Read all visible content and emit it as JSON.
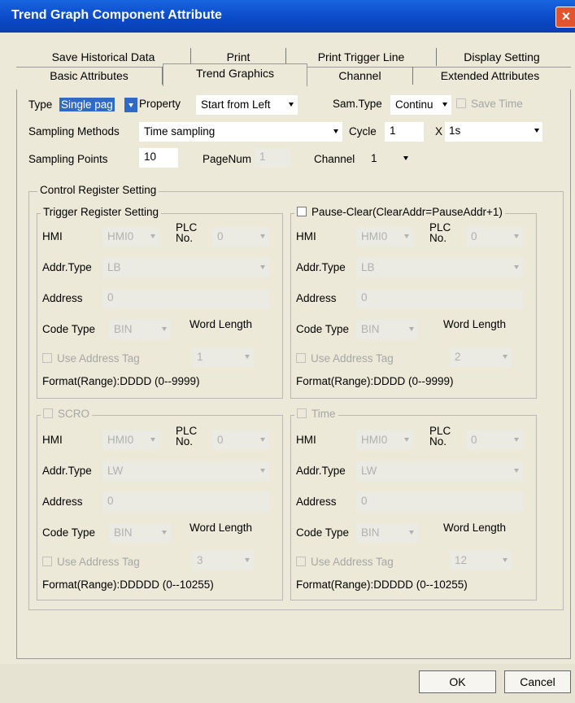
{
  "window": {
    "title": "Trend Graph Component Attribute",
    "close": "×"
  },
  "tabs": {
    "row1": [
      "Save Historical Data",
      "Print",
      "Print Trigger Line",
      "Display Setting"
    ],
    "row2": [
      "Basic Attributes",
      "Trend Graphics",
      "Channel",
      "Extended Attributes"
    ],
    "active": "Trend Graphics"
  },
  "top": {
    "type_label": "Type",
    "type_value": "Single pag",
    "property_label": "Property",
    "property_value": "Start from Left",
    "samtype_label": "Sam.Type",
    "samtype_value": "Continu",
    "savetime_label": "Save Time",
    "sampling_methods_label": "Sampling Methods",
    "sampling_methods_value": "Time sampling",
    "cycle_label": "Cycle",
    "cycle_value": "1",
    "times": "X",
    "cycle_unit": "1s",
    "sampling_points_label": "Sampling Points",
    "sampling_points_value": "10",
    "pagenum_label": "PageNum",
    "pagenum_value": "1",
    "channel_label": "Channel",
    "channel_value": "1"
  },
  "control": {
    "title": "Control Register Setting",
    "groups": [
      {
        "title": "Trigger Register Setting",
        "checkbox": false,
        "hmi": "HMI",
        "hmi_value": "HMI0",
        "plc": "PLC\nNo.",
        "plc_value": "0",
        "addrtype": "Addr.Type",
        "addrtype_value": "LB",
        "address": "Address",
        "address_value": "0",
        "codetype": "Code Type",
        "codetype_value": "BIN",
        "wordlength": "Word Length",
        "wordlength_value": "1",
        "use_tag": "Use Address Tag",
        "format": "Format(Range):DDDD (0--9999)"
      },
      {
        "title": "Pause-Clear(ClearAddr=PauseAddr+1)",
        "checkbox": true,
        "hmi": "HMI",
        "hmi_value": "HMI0",
        "plc": "PLC\nNo.",
        "plc_value": "0",
        "addrtype": "Addr.Type",
        "addrtype_value": "LB",
        "address": "Address",
        "address_value": "0",
        "codetype": "Code Type",
        "codetype_value": "BIN",
        "wordlength": "Word Length",
        "wordlength_value": "2",
        "use_tag": "Use Address Tag",
        "format": "Format(Range):DDDD (0--9999)"
      },
      {
        "title": "SCRO",
        "checkbox": true,
        "hmi": "HMI",
        "hmi_value": "HMI0",
        "plc": "PLC\nNo.",
        "plc_value": "0",
        "addrtype": "Addr.Type",
        "addrtype_value": "LW",
        "address": "Address",
        "address_value": "0",
        "codetype": "Code Type",
        "codetype_value": "BIN",
        "wordlength": "Word Length",
        "wordlength_value": "3",
        "use_tag": "Use Address Tag",
        "format": "Format(Range):DDDDD (0--10255)"
      },
      {
        "title": "Time",
        "checkbox": true,
        "hmi": "HMI",
        "hmi_value": "HMI0",
        "plc": "PLC\nNo.",
        "plc_value": "0",
        "addrtype": "Addr.Type",
        "addrtype_value": "LW",
        "address": "Address",
        "address_value": "0",
        "codetype": "Code Type",
        "codetype_value": "BIN",
        "wordlength": "Word Length",
        "wordlength_value": "12",
        "use_tag": "Use Address Tag",
        "format": "Format(Range):DDDDD (0--10255)"
      }
    ]
  },
  "buttons": {
    "ok": "OK",
    "cancel": "Cancel"
  }
}
